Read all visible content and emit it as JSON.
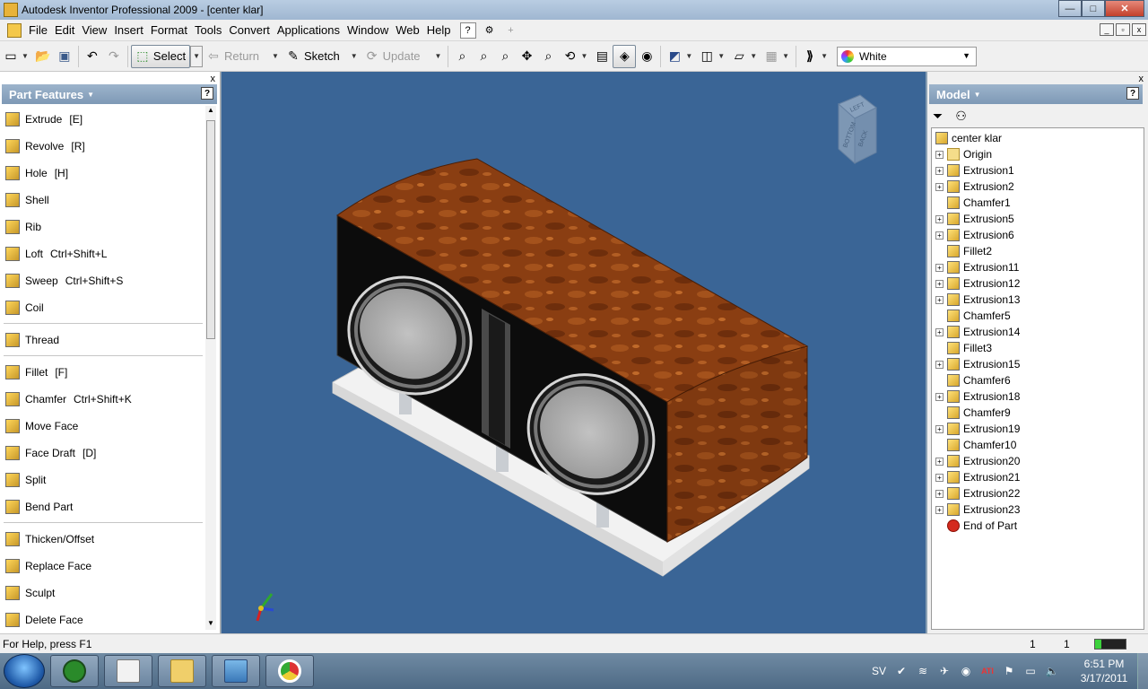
{
  "window": {
    "title": "Autodesk Inventor Professional 2009 - [center klar]",
    "buttons": {
      "minimize": "—",
      "maximize": "□",
      "close": "✕"
    }
  },
  "menu": {
    "items": [
      "File",
      "Edit",
      "View",
      "Insert",
      "Format",
      "Tools",
      "Convert",
      "Applications",
      "Window",
      "Web",
      "Help"
    ]
  },
  "toolbar": {
    "select_label": "Select",
    "return_label": "Return",
    "sketch_label": "Sketch",
    "update_label": "Update",
    "color_value": "White"
  },
  "left_panel": {
    "title": "Part Features",
    "help": "?",
    "close": "x",
    "features": [
      {
        "label": "Extrude",
        "key": "[E]"
      },
      {
        "label": "Revolve",
        "key": "[R]"
      },
      {
        "label": "Hole",
        "key": "[H]"
      },
      {
        "label": "Shell",
        "key": ""
      },
      {
        "label": "Rib",
        "key": ""
      },
      {
        "label": "Loft",
        "key": "Ctrl+Shift+L"
      },
      {
        "label": "Sweep",
        "key": "Ctrl+Shift+S"
      },
      {
        "label": "Coil",
        "key": ""
      },
      {
        "label": "Thread",
        "key": ""
      },
      {
        "label": "Fillet",
        "key": "[F]"
      },
      {
        "label": "Chamfer",
        "key": "Ctrl+Shift+K"
      },
      {
        "label": "Move Face",
        "key": ""
      },
      {
        "label": "Face Draft",
        "key": "[D]"
      },
      {
        "label": "Split",
        "key": ""
      },
      {
        "label": "Bend Part",
        "key": ""
      },
      {
        "label": "Thicken/Offset",
        "key": ""
      },
      {
        "label": "Replace Face",
        "key": ""
      },
      {
        "label": "Sculpt",
        "key": ""
      },
      {
        "label": "Delete Face",
        "key": ""
      }
    ]
  },
  "viewport": {
    "background": "#3a6596",
    "viewcube_labels": {
      "top": "LEFT",
      "front": "BOTTOM",
      "right": "BACK"
    }
  },
  "right_panel": {
    "title": "Model",
    "help": "?",
    "close": "x",
    "tree": [
      {
        "label": "center klar",
        "type": "root",
        "expandable": false
      },
      {
        "label": "Origin",
        "type": "folder",
        "expandable": true
      },
      {
        "label": "Extrusion1",
        "type": "extrusion",
        "expandable": true
      },
      {
        "label": "Extrusion2",
        "type": "extrusion",
        "expandable": true
      },
      {
        "label": "Chamfer1",
        "type": "chamfer",
        "expandable": false
      },
      {
        "label": "Extrusion5",
        "type": "extrusion",
        "expandable": true
      },
      {
        "label": "Extrusion6",
        "type": "extrusion",
        "expandable": true
      },
      {
        "label": "Fillet2",
        "type": "fillet",
        "expandable": false
      },
      {
        "label": "Extrusion11",
        "type": "extrusion",
        "expandable": true
      },
      {
        "label": "Extrusion12",
        "type": "extrusion",
        "expandable": true
      },
      {
        "label": "Extrusion13",
        "type": "extrusion",
        "expandable": true
      },
      {
        "label": "Chamfer5",
        "type": "chamfer",
        "expandable": false
      },
      {
        "label": "Extrusion14",
        "type": "extrusion",
        "expandable": true
      },
      {
        "label": "Fillet3",
        "type": "fillet",
        "expandable": false
      },
      {
        "label": "Extrusion15",
        "type": "extrusion",
        "expandable": true
      },
      {
        "label": "Chamfer6",
        "type": "chamfer",
        "expandable": false
      },
      {
        "label": "Extrusion18",
        "type": "extrusion",
        "expandable": true
      },
      {
        "label": "Chamfer9",
        "type": "chamfer",
        "expandable": false
      },
      {
        "label": "Extrusion19",
        "type": "extrusion",
        "expandable": true
      },
      {
        "label": "Chamfer10",
        "type": "chamfer",
        "expandable": false
      },
      {
        "label": "Extrusion20",
        "type": "extrusion",
        "expandable": true
      },
      {
        "label": "Extrusion21",
        "type": "extrusion",
        "expandable": true
      },
      {
        "label": "Extrusion22",
        "type": "extrusion",
        "expandable": true
      },
      {
        "label": "Extrusion23",
        "type": "extrusion",
        "expandable": true
      },
      {
        "label": "End of Part",
        "type": "end",
        "expandable": false
      }
    ]
  },
  "status": {
    "help_text": "For Help, press F1",
    "count1": "1",
    "count2": "1"
  },
  "taskbar": {
    "lang": "SV",
    "time": "6:51 PM",
    "date": "3/17/2011"
  }
}
